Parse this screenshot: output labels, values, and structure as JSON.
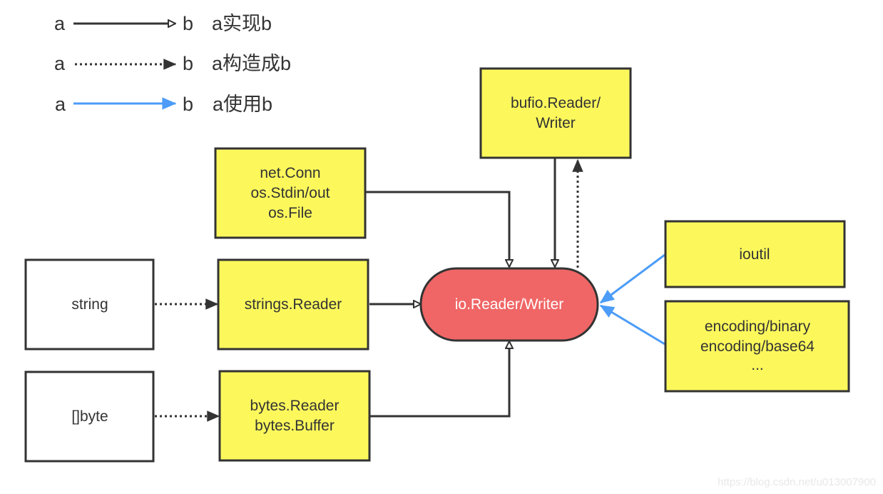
{
  "legend": [
    {
      "from": "a",
      "to": "b",
      "style": "solid-hollow-arrow",
      "label": "a实现b"
    },
    {
      "from": "a",
      "to": "b",
      "style": "dotted-filled-arrow",
      "label": "a构造成b"
    },
    {
      "from": "a",
      "to": "b",
      "style": "blue-filled-arrow",
      "label": "a使用b"
    }
  ],
  "colors": {
    "yellow_fill": "#fcf85c",
    "core_fill": "#f06666",
    "stroke": "#333333",
    "use_arrow": "#4c9cf8",
    "white_fill": "#ffffff"
  },
  "nodes": {
    "bufio": {
      "lines": [
        "bufio.Reader/",
        "Writer"
      ]
    },
    "net": {
      "lines": [
        "net.Conn",
        "os.Stdin/out",
        "os.File"
      ]
    },
    "string": {
      "lines": [
        "string"
      ]
    },
    "strings_reader": {
      "lines": [
        "strings.Reader"
      ]
    },
    "byte": {
      "lines": [
        "[]byte"
      ]
    },
    "bytes_reader": {
      "lines": [
        "bytes.Reader",
        "bytes.Buffer"
      ]
    },
    "core": {
      "lines": [
        "io.Reader/Writer"
      ]
    },
    "ioutil": {
      "lines": [
        "ioutil"
      ]
    },
    "encoding": {
      "lines": [
        "encoding/binary",
        "encoding/base64",
        "..."
      ]
    }
  },
  "edges": [
    {
      "from": "net",
      "to": "core",
      "type": "implements"
    },
    {
      "from": "bufio",
      "to": "core",
      "type": "implements"
    },
    {
      "from": "core",
      "to": "bufio",
      "type": "constructs"
    },
    {
      "from": "string",
      "to": "strings_reader",
      "type": "constructs"
    },
    {
      "from": "strings_reader",
      "to": "core",
      "type": "implements"
    },
    {
      "from": "byte",
      "to": "bytes_reader",
      "type": "constructs"
    },
    {
      "from": "bytes_reader",
      "to": "core",
      "type": "implements"
    },
    {
      "from": "ioutil",
      "to": "core",
      "type": "uses"
    },
    {
      "from": "encoding",
      "to": "core",
      "type": "uses"
    }
  ],
  "watermark": "https://blog.csdn.net/u013007900"
}
